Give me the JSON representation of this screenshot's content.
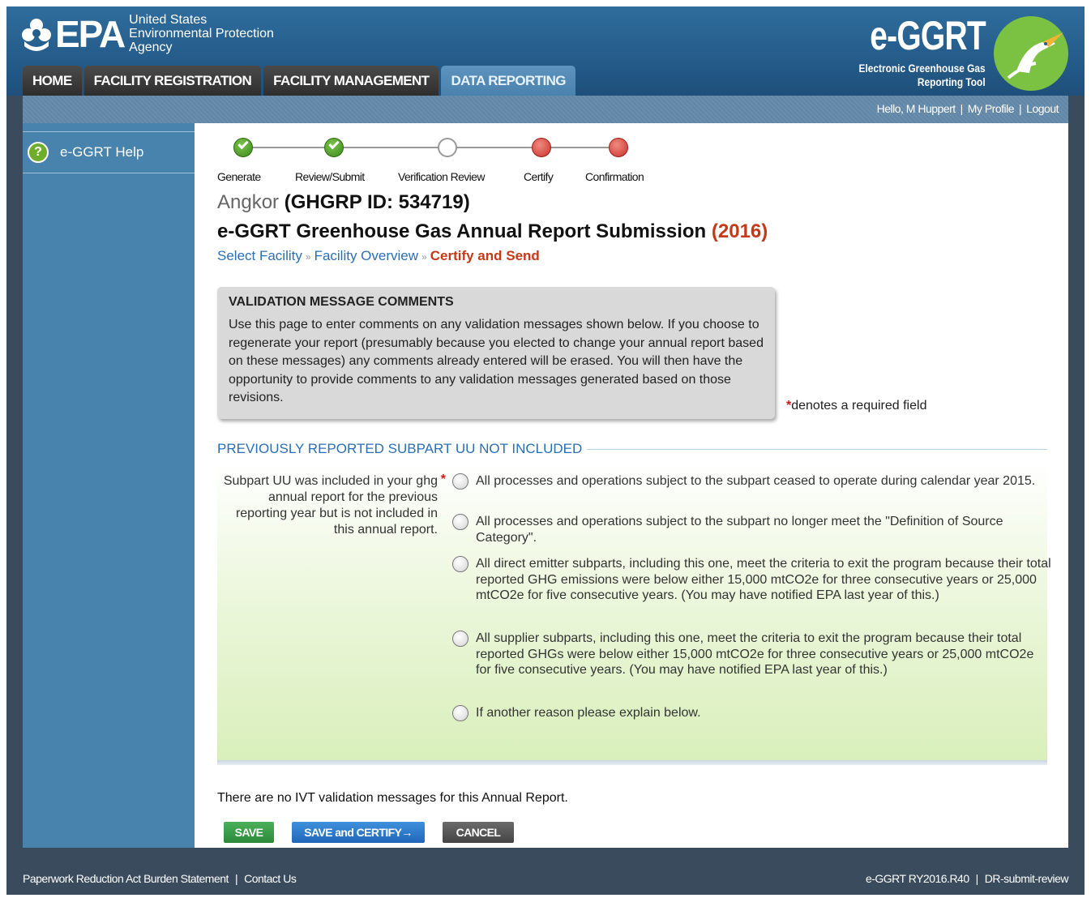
{
  "header": {
    "agency_abbr": "EPA",
    "agency_line1": "United States",
    "agency_line2": "Environmental Protection",
    "agency_line3": "Agency",
    "product_name": "e-GGRT",
    "product_tag_line1": "Electronic Greenhouse Gas",
    "product_tag_line2": "Reporting Tool",
    "colors": {
      "header_blue": "#255d8c",
      "tab_dark": "#2e2e2e",
      "tab_active": "#4a82ae"
    }
  },
  "nav": {
    "tabs": [
      {
        "label": "HOME"
      },
      {
        "label": "FACILITY REGISTRATION"
      },
      {
        "label": "FACILITY MANAGEMENT"
      },
      {
        "label": "DATA REPORTING"
      }
    ],
    "active": "DATA REPORTING"
  },
  "user": {
    "greeting": "Hello, M Huppert",
    "profile_link": "My Profile",
    "logout_link": "Logout"
  },
  "sidebar": {
    "help_label": "e-GGRT Help",
    "help_icon": "question-icon"
  },
  "steps": [
    {
      "label": "Generate",
      "state": "done"
    },
    {
      "label": "Review/Submit",
      "state": "done"
    },
    {
      "label": "Verification Review",
      "state": "open"
    },
    {
      "label": "Certify",
      "state": "pending"
    },
    {
      "label": "Confirmation",
      "state": "pending"
    }
  ],
  "facility": {
    "name": "Angkor",
    "id_text": "(GHGRP ID: 534719)"
  },
  "page": {
    "title": "e-GGRT Greenhouse Gas Annual Report Submission",
    "year": "(2016)"
  },
  "breadcrumb": {
    "items": [
      "Select Facility",
      "Facility Overview"
    ],
    "current": "Certify and Send",
    "separator": "»"
  },
  "validation_box": {
    "heading": "VALIDATION MESSAGE COMMENTS",
    "body": "Use this page to enter comments on any validation messages shown below. If you choose to regenerate your report (presumably because you elected to change your annual report based on these messages) any comments already entered will be erased. You will then have the opportunity to provide comments to any validation messages generated based on those revisions."
  },
  "required_note": {
    "star": "*",
    "text": "denotes a required field"
  },
  "section": {
    "title": "PREVIOUSLY REPORTED SUBPART UU NOT INCLUDED",
    "question": "Subpart UU was included in your ghg annual report for the previous reporting year but is not included in this annual report.",
    "question_star": "*",
    "options": [
      "All processes and operations subject to the subpart ceased to operate during calendar year 2015.",
      "All processes and operations subject to the subpart no longer meet the \"Definition of Source Category\".",
      "All direct emitter subparts, including this one, meet the criteria to exit the program because their total reported GHG emissions were below either 15,000 mtCO2e for three consecutive years or 25,000 mtCO2e for five consecutive years. (You may have notified EPA last year of this.)",
      "All supplier subparts, including this one, meet the criteria to exit the program because their total reported GHGs were below either 15,000 mtCO2e for three consecutive years or 25,000 mtCO2e for five consecutive years. (You may have notified EPA last year of this.)",
      "If another reason please explain below."
    ]
  },
  "messages": {
    "no_ivt": "There are no IVT validation messages for this Annual Report."
  },
  "buttons": {
    "save": "SAVE",
    "save_certify": "SAVE and CERTIFY",
    "save_certify_arrow": "→",
    "cancel": "CANCEL"
  },
  "footer": {
    "paperwork": "Paperwork Reduction Act Burden Statement",
    "contact": "Contact Us",
    "version": "e-GGRT RY2016.R40",
    "page_id": "DR-submit-review"
  }
}
